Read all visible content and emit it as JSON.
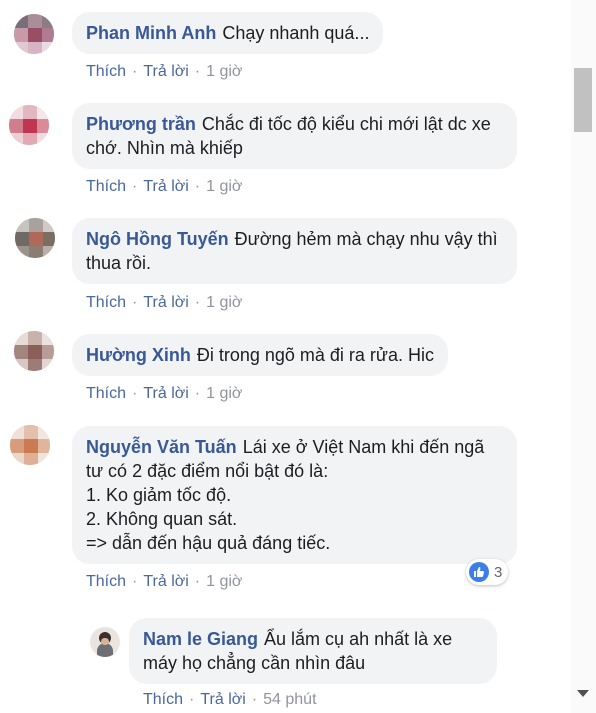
{
  "comments": [
    {
      "name": "Phan Minh Anh",
      "text": "Chạy nhanh quá...",
      "like": "Thích",
      "reply": "Trả lời",
      "time": "1 giờ"
    },
    {
      "name": "Phương trần",
      "text": "Chắc đi tốc độ kiểu chi mới lật dc xe chớ. Nhìn mà khiếp",
      "like": "Thích",
      "reply": "Trả lời",
      "time": "1 giờ"
    },
    {
      "name": "Ngô Hồng Tuyến",
      "text": "Đường hẻm mà chạy nhu vậy thì thua rồi.",
      "like": "Thích",
      "reply": "Trả lời",
      "time": "1 giờ"
    },
    {
      "name": "Hường Xinh",
      "text": "Đi trong ngõ mà đi ra rửa. Hic",
      "like": "Thích",
      "reply": "Trả lời",
      "time": "1 giờ"
    },
    {
      "name": "Nguyễn Văn Tuấn",
      "text_lines": [
        "Lái xe ở Việt Nam khi đến ngã tư có 2 đặc điểm nổi bật đó là:",
        "1. Ko giảm tốc độ.",
        "2. Không quan sát.",
        "=> dẫn đến hậu quả đáng tiếc."
      ],
      "like": "Thích",
      "reply": "Trả lời",
      "time": "1 giờ",
      "reaction_count": "3"
    }
  ],
  "reply": {
    "name": "Nam le Giang",
    "text": "Ẩu lắm cụ ah nhất là xe máy họ chẳng cần nhìn đâu",
    "like": "Thích",
    "reply": "Trả lời",
    "time": "54 phút"
  },
  "icons": {
    "like_reaction": "thumbs-up-icon",
    "scroll_down": "chevron-down-icon"
  },
  "colors": {
    "name": "#385898",
    "action_link": "#4b67a1",
    "bubble": "#f2f3f5",
    "like_blue": "#3b7ee8"
  }
}
